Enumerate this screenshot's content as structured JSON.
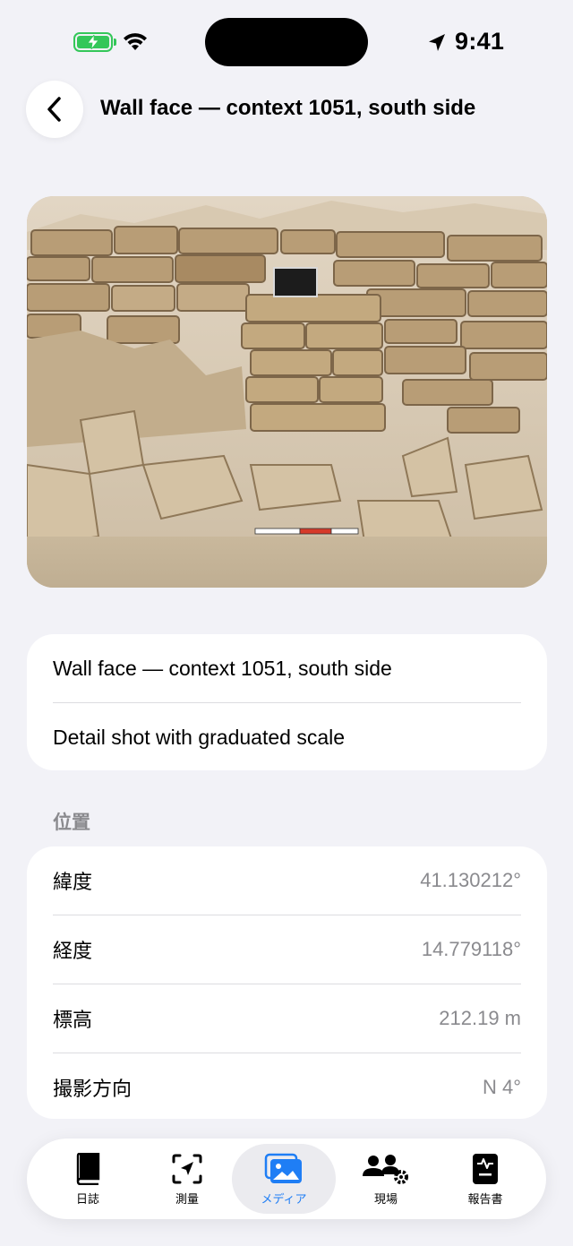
{
  "status_bar": {
    "time": "9:41"
  },
  "header": {
    "title": "Wall face — context 1051, south side"
  },
  "photo": {
    "description_icon": "wall-photo"
  },
  "caption": {
    "title": "Wall face — context 1051, south side",
    "subtitle": "Detail shot with graduated scale"
  },
  "location": {
    "section_title": "位置",
    "rows": [
      {
        "label": "緯度",
        "value": "41.130212°"
      },
      {
        "label": "経度",
        "value": "14.779118°"
      },
      {
        "label": "標高",
        "value": "212.19 m"
      },
      {
        "label": "撮影方向",
        "value": "N 4°"
      }
    ]
  },
  "tabs": [
    {
      "label": "日誌",
      "icon": "book-icon",
      "active": false
    },
    {
      "label": "測量",
      "icon": "survey-icon",
      "active": false
    },
    {
      "label": "メディア",
      "icon": "photos-icon",
      "active": true
    },
    {
      "label": "現場",
      "icon": "people-gear-icon",
      "active": false
    },
    {
      "label": "報告書",
      "icon": "report-icon",
      "active": false
    }
  ],
  "colors": {
    "accent": "#1f7ef5",
    "battery": "#34c759",
    "background": "#f2f2f7",
    "secondary_text": "#8a8a8e"
  }
}
